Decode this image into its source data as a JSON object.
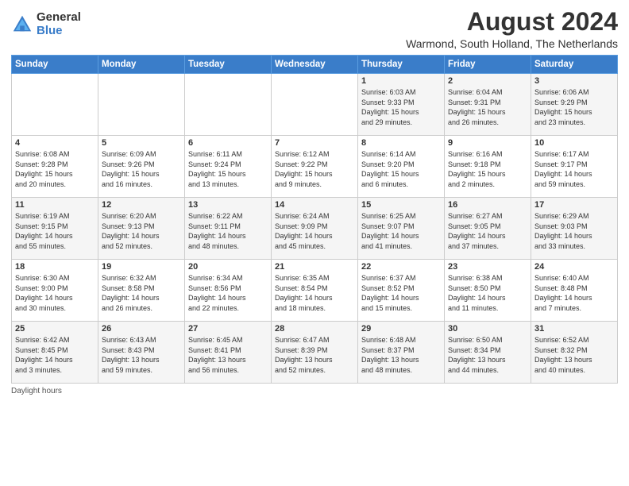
{
  "logo": {
    "general": "General",
    "blue": "Blue"
  },
  "title": "August 2024",
  "subtitle": "Warmond, South Holland, The Netherlands",
  "weekdays": [
    "Sunday",
    "Monday",
    "Tuesday",
    "Wednesday",
    "Thursday",
    "Friday",
    "Saturday"
  ],
  "footer": "Daylight hours",
  "weeks": [
    [
      {
        "day": "",
        "info": ""
      },
      {
        "day": "",
        "info": ""
      },
      {
        "day": "",
        "info": ""
      },
      {
        "day": "",
        "info": ""
      },
      {
        "day": "1",
        "info": "Sunrise: 6:03 AM\nSunset: 9:33 PM\nDaylight: 15 hours\nand 29 minutes."
      },
      {
        "day": "2",
        "info": "Sunrise: 6:04 AM\nSunset: 9:31 PM\nDaylight: 15 hours\nand 26 minutes."
      },
      {
        "day": "3",
        "info": "Sunrise: 6:06 AM\nSunset: 9:29 PM\nDaylight: 15 hours\nand 23 minutes."
      }
    ],
    [
      {
        "day": "4",
        "info": "Sunrise: 6:08 AM\nSunset: 9:28 PM\nDaylight: 15 hours\nand 20 minutes."
      },
      {
        "day": "5",
        "info": "Sunrise: 6:09 AM\nSunset: 9:26 PM\nDaylight: 15 hours\nand 16 minutes."
      },
      {
        "day": "6",
        "info": "Sunrise: 6:11 AM\nSunset: 9:24 PM\nDaylight: 15 hours\nand 13 minutes."
      },
      {
        "day": "7",
        "info": "Sunrise: 6:12 AM\nSunset: 9:22 PM\nDaylight: 15 hours\nand 9 minutes."
      },
      {
        "day": "8",
        "info": "Sunrise: 6:14 AM\nSunset: 9:20 PM\nDaylight: 15 hours\nand 6 minutes."
      },
      {
        "day": "9",
        "info": "Sunrise: 6:16 AM\nSunset: 9:18 PM\nDaylight: 15 hours\nand 2 minutes."
      },
      {
        "day": "10",
        "info": "Sunrise: 6:17 AM\nSunset: 9:17 PM\nDaylight: 14 hours\nand 59 minutes."
      }
    ],
    [
      {
        "day": "11",
        "info": "Sunrise: 6:19 AM\nSunset: 9:15 PM\nDaylight: 14 hours\nand 55 minutes."
      },
      {
        "day": "12",
        "info": "Sunrise: 6:20 AM\nSunset: 9:13 PM\nDaylight: 14 hours\nand 52 minutes."
      },
      {
        "day": "13",
        "info": "Sunrise: 6:22 AM\nSunset: 9:11 PM\nDaylight: 14 hours\nand 48 minutes."
      },
      {
        "day": "14",
        "info": "Sunrise: 6:24 AM\nSunset: 9:09 PM\nDaylight: 14 hours\nand 45 minutes."
      },
      {
        "day": "15",
        "info": "Sunrise: 6:25 AM\nSunset: 9:07 PM\nDaylight: 14 hours\nand 41 minutes."
      },
      {
        "day": "16",
        "info": "Sunrise: 6:27 AM\nSunset: 9:05 PM\nDaylight: 14 hours\nand 37 minutes."
      },
      {
        "day": "17",
        "info": "Sunrise: 6:29 AM\nSunset: 9:03 PM\nDaylight: 14 hours\nand 33 minutes."
      }
    ],
    [
      {
        "day": "18",
        "info": "Sunrise: 6:30 AM\nSunset: 9:00 PM\nDaylight: 14 hours\nand 30 minutes."
      },
      {
        "day": "19",
        "info": "Sunrise: 6:32 AM\nSunset: 8:58 PM\nDaylight: 14 hours\nand 26 minutes."
      },
      {
        "day": "20",
        "info": "Sunrise: 6:34 AM\nSunset: 8:56 PM\nDaylight: 14 hours\nand 22 minutes."
      },
      {
        "day": "21",
        "info": "Sunrise: 6:35 AM\nSunset: 8:54 PM\nDaylight: 14 hours\nand 18 minutes."
      },
      {
        "day": "22",
        "info": "Sunrise: 6:37 AM\nSunset: 8:52 PM\nDaylight: 14 hours\nand 15 minutes."
      },
      {
        "day": "23",
        "info": "Sunrise: 6:38 AM\nSunset: 8:50 PM\nDaylight: 14 hours\nand 11 minutes."
      },
      {
        "day": "24",
        "info": "Sunrise: 6:40 AM\nSunset: 8:48 PM\nDaylight: 14 hours\nand 7 minutes."
      }
    ],
    [
      {
        "day": "25",
        "info": "Sunrise: 6:42 AM\nSunset: 8:45 PM\nDaylight: 14 hours\nand 3 minutes."
      },
      {
        "day": "26",
        "info": "Sunrise: 6:43 AM\nSunset: 8:43 PM\nDaylight: 13 hours\nand 59 minutes."
      },
      {
        "day": "27",
        "info": "Sunrise: 6:45 AM\nSunset: 8:41 PM\nDaylight: 13 hours\nand 56 minutes."
      },
      {
        "day": "28",
        "info": "Sunrise: 6:47 AM\nSunset: 8:39 PM\nDaylight: 13 hours\nand 52 minutes."
      },
      {
        "day": "29",
        "info": "Sunrise: 6:48 AM\nSunset: 8:37 PM\nDaylight: 13 hours\nand 48 minutes."
      },
      {
        "day": "30",
        "info": "Sunrise: 6:50 AM\nSunset: 8:34 PM\nDaylight: 13 hours\nand 44 minutes."
      },
      {
        "day": "31",
        "info": "Sunrise: 6:52 AM\nSunset: 8:32 PM\nDaylight: 13 hours\nand 40 minutes."
      }
    ]
  ]
}
